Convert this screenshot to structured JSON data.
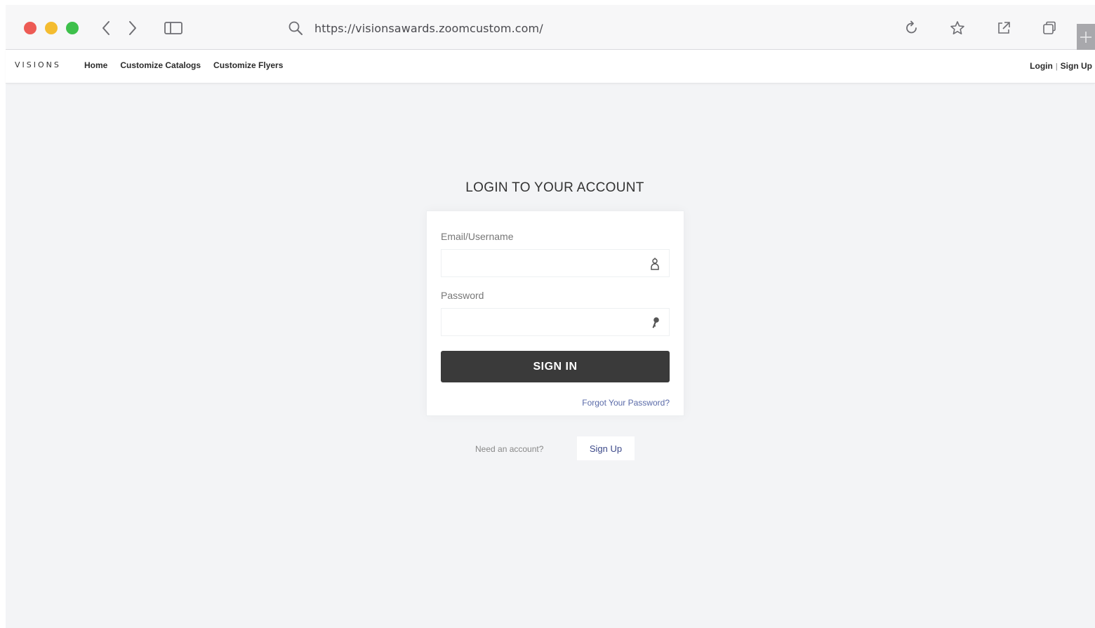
{
  "browser": {
    "url": "https://visionsawards.zoomcustom.com/",
    "icons": [
      "back-icon",
      "forward-icon",
      "sidebar-icon",
      "search-icon",
      "reload-icon",
      "bookmark-star-icon",
      "share-icon",
      "tabs-icon",
      "new-tab-icon"
    ],
    "traffic_colors": {
      "close": "#ed5b55",
      "minimize": "#f4bc30",
      "zoom": "#3ec04b"
    }
  },
  "site": {
    "logo": "VISIONS",
    "nav": [
      "Home",
      "Customize Catalogs",
      "Customize Flyers"
    ],
    "auth": {
      "login": "Login",
      "separator": "|",
      "signup": "Sign Up"
    }
  },
  "login": {
    "title": "LOGIN TO YOUR ACCOUNT",
    "email_label": "Email/Username",
    "email_value": "",
    "password_label": "Password",
    "password_value": "",
    "submit_label": "SIGN IN",
    "forgot_label": "Forgot Your Password?",
    "need_account": "Need an account?",
    "signup_label": "Sign Up",
    "button_color": "#3a3a3a",
    "link_color": "#5a6aa8"
  }
}
